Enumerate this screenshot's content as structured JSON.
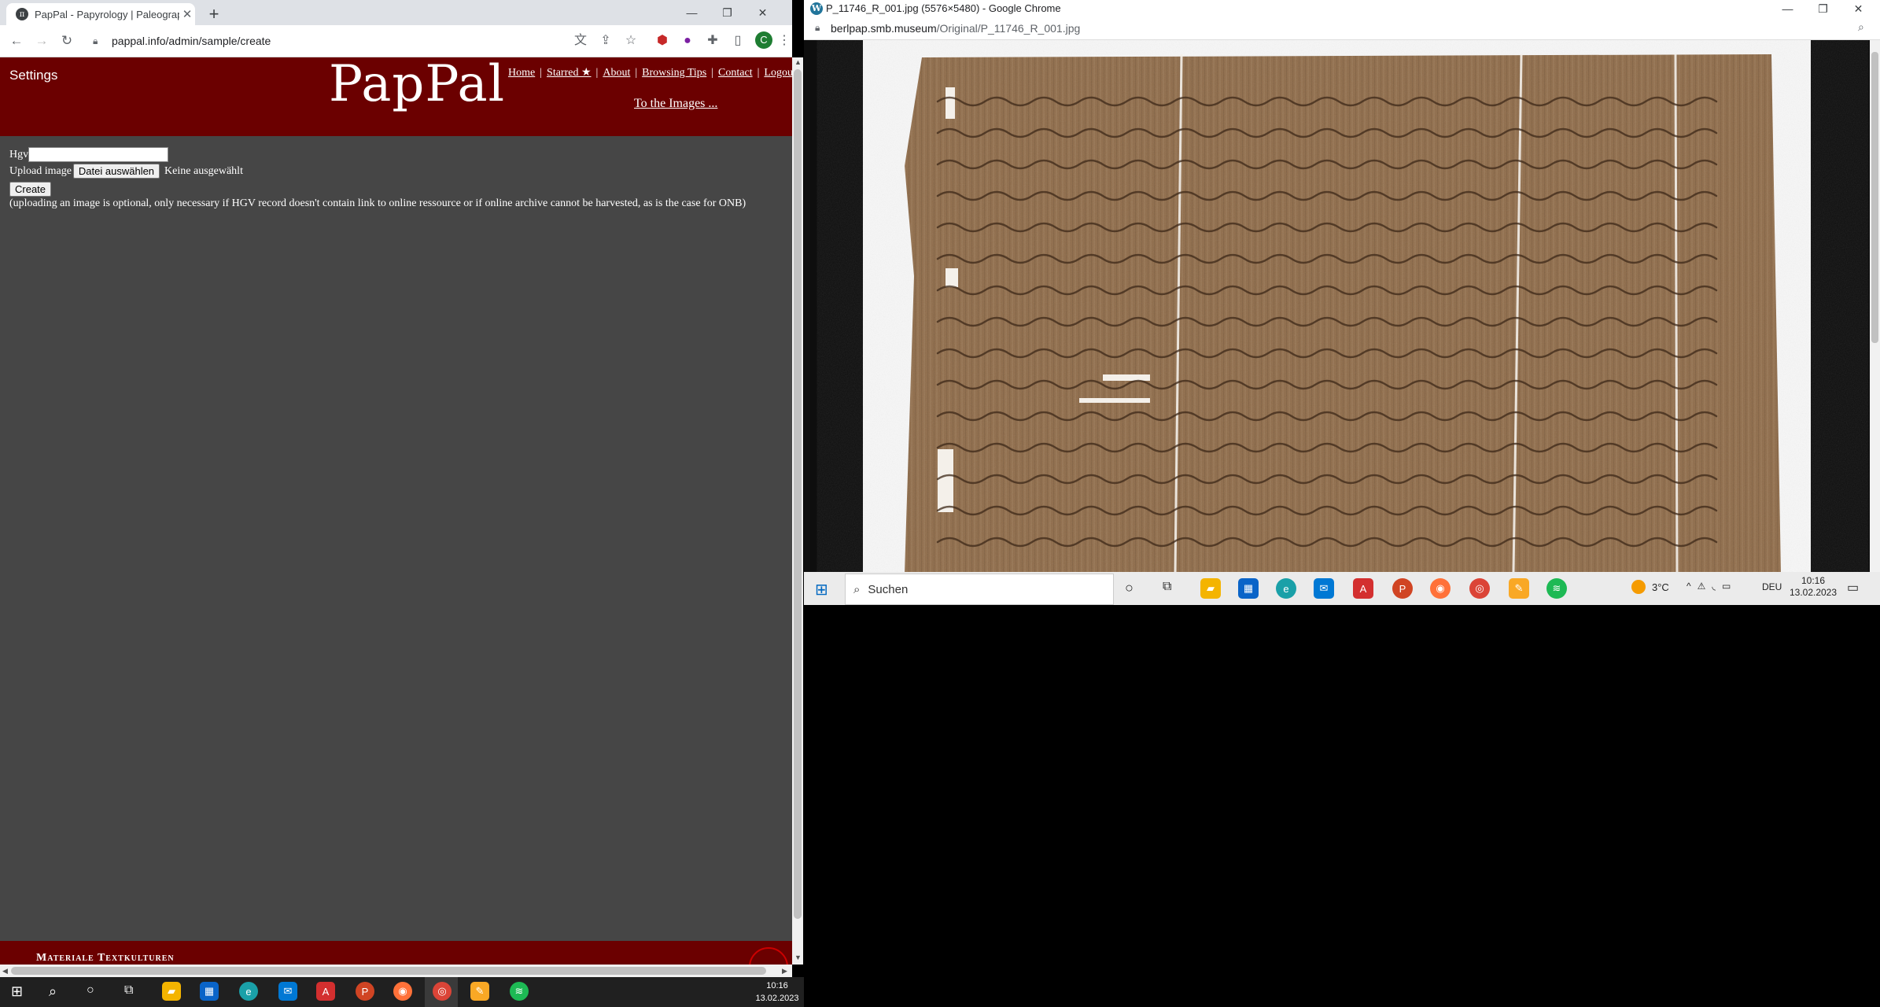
{
  "left_browser": {
    "tab_title": "PapPal - Papyrology | Paleograph",
    "url": "pappal.info/admin/sample/create",
    "window_buttons": {
      "minimize": "—",
      "restore": "❐",
      "close": "✕"
    },
    "avatar_letter": "C"
  },
  "page": {
    "settings_label": "Settings",
    "logo": "PapPal",
    "nav": [
      "Home",
      "Starred ★",
      "About",
      "Browsing Tips",
      "Contact",
      "Logout"
    ],
    "to_images": "To the Images ...",
    "form": {
      "hgv_label": "Hgv",
      "hgv_value": "",
      "upload_label": "Upload image",
      "file_button": "Datei auswählen",
      "file_status": "Keine ausgewählt",
      "create_button": "Create",
      "note": "(uploading an image is optional, only necessary if HGV record doesn't contain link to online ressource or if online archive cannot be harvested, as is the case for ONB)"
    },
    "footer_text": "Materiale Textkulturen"
  },
  "right_browser": {
    "title": "P_11746_R_001.jpg (5576×5480) - Google Chrome",
    "url_host": "berlpap.smb.museum",
    "url_path": "/Original/P_11746_R_001.jpg",
    "window_buttons": {
      "minimize": "—",
      "restore": "❐",
      "close": "✕"
    }
  },
  "right_taskbar": {
    "search_placeholder": "Suchen",
    "weather": "3°C",
    "language": "DEU",
    "time": "10:16",
    "date": "13.02.2023"
  },
  "bottom_taskbar": {
    "time": "10:16",
    "date": "13.02.2023"
  },
  "colors": {
    "header_red": "#6b0000",
    "page_bg": "#464646",
    "papyrus": "#8f6c4a"
  }
}
